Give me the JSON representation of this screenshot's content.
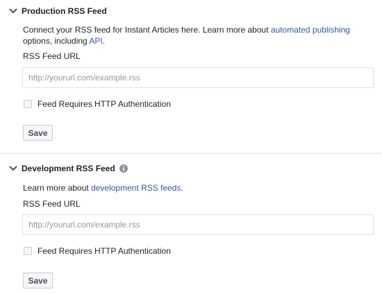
{
  "production": {
    "title": "Production RSS Feed",
    "desc_prefix": "Connect your RSS feed for Instant Articles here. Learn more about ",
    "desc_link1": "automated publishing",
    "desc_middle": " options, including ",
    "desc_link2": "API",
    "desc_suffix": ".",
    "field_label": "RSS Feed URL",
    "url_placeholder": "http://yoururl.com/example.rss",
    "url_value": "",
    "auth_label": "Feed Requires HTTP Authentication",
    "auth_checked": false,
    "save_label": "Save"
  },
  "development": {
    "title": "Development RSS Feed",
    "desc_prefix": "Learn more about ",
    "desc_link": "development RSS feeds",
    "desc_suffix": ".",
    "field_label": "RSS Feed URL",
    "url_placeholder": "http://yoururl.com/example.rss",
    "url_value": "",
    "auth_label": "Feed Requires HTTP Authentication",
    "auth_checked": false,
    "save_label": "Save"
  },
  "icons": {
    "collapse": "chevron-down-icon",
    "info": "info-icon"
  },
  "colors": {
    "link": "#365899",
    "text": "#1d2129",
    "border": "#dddfe2"
  }
}
